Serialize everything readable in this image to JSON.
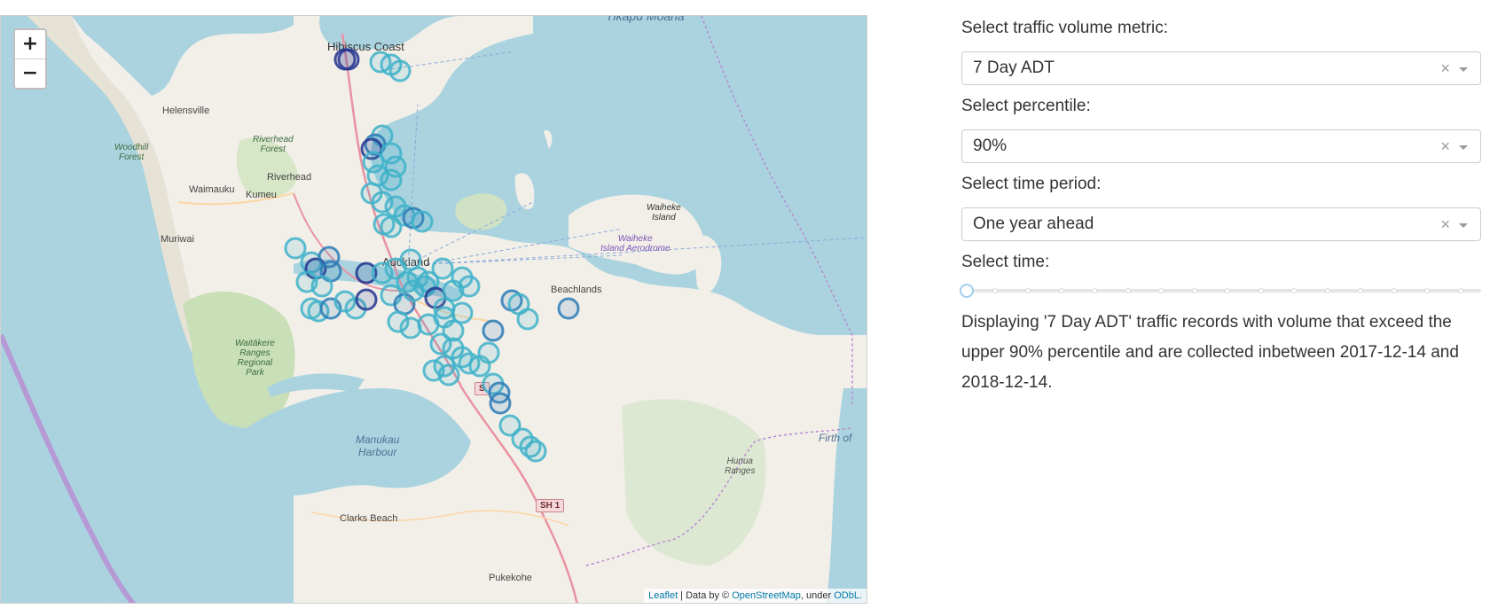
{
  "map": {
    "zoom_in": "+",
    "zoom_out": "−",
    "attribution": {
      "leaflet": "Leaflet",
      "middle": " | Data by © ",
      "osm": "OpenStreetMap",
      "under": ", under ",
      "odbl": "ODbL."
    },
    "places": {
      "hibiscus_coast": "Hibiscus Coast",
      "tikapu_moana": "Tīkapu Moana",
      "helensville": "Helensville",
      "woodhill": "Woodhill\nForest",
      "riverhead_forest": "Riverhead\nForest",
      "riverhead": "Riverhead",
      "waimauku": "Waimauku",
      "kumeu": "Kumeu",
      "muriwai": "Muriwai",
      "auckland": "Auckland",
      "beachlands": "Beachlands",
      "waiheke": "Waiheke\nIsland",
      "waiheke_aero": "Waiheke\nIsland Aerodrome",
      "waitakere": "Waitākere\nRanges\nRegional\nPark",
      "manukau": "Manukau\nHarbour",
      "clarks_beach": "Clarks Beach",
      "pukekohe": "Pukekohe",
      "hunua": "Hunua\nRanges",
      "firth": "Firth of"
    },
    "shields": {
      "sh1": "SH 1",
      "s": "S"
    },
    "marker_colors": {
      "light": "#3fb1c9",
      "mid": "#2c7bb6",
      "dark": "#23358f"
    }
  },
  "panel": {
    "metric_label": "Select traffic volume metric:",
    "metric_value": "7 Day ADT",
    "percentile_label": "Select percentile:",
    "percentile_value": "90%",
    "period_label": "Select time period:",
    "period_value": "One year ahead",
    "clear_symbol": "×",
    "time_label": "Select time:",
    "time_slider_value": 0,
    "description": "Displaying '7 Day ADT' traffic records with volume that exceed the upper 90% percentile and are collected inbetween 2017-12-14 and 2018-12-14."
  }
}
